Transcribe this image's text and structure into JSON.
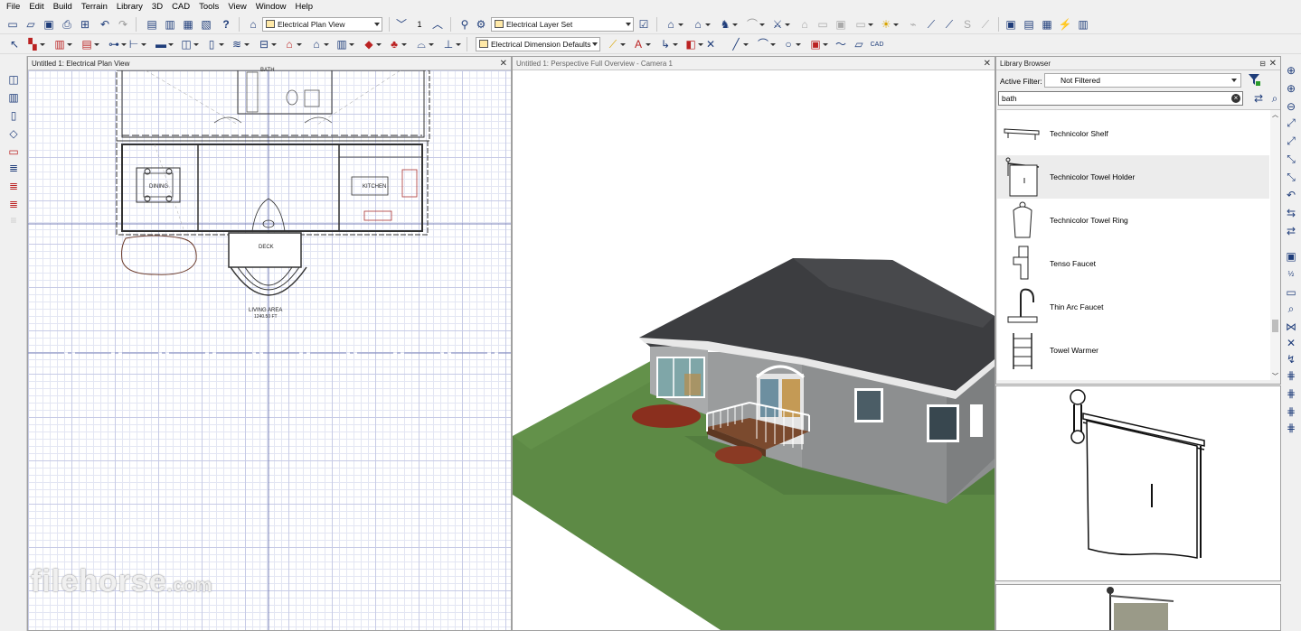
{
  "menu": [
    "File",
    "Edit",
    "Build",
    "Terrain",
    "Library",
    "3D",
    "CAD",
    "Tools",
    "View",
    "Window",
    "Help"
  ],
  "toolbar": {
    "view_select": "Electrical Plan View",
    "floor_number": "1",
    "layer_set": "Electrical Layer Set",
    "dimension_defaults": "Electrical Dimension Defaults"
  },
  "panes": {
    "plan": {
      "title": "Untitled 1: Electrical Plan View",
      "rooms": {
        "bath": "BATH",
        "dining": "DINING",
        "kitchen": "KITCHEN",
        "deck": "DECK",
        "living": "LIVING AREA",
        "living_area": "1240.50 FT"
      }
    },
    "perspective": {
      "title": "Untitled 1: Perspective Full Overview - Camera 1"
    },
    "library": {
      "title": "Library Browser",
      "filter_label": "Active Filter:",
      "filter_value": "Not Filtered",
      "search_value": "bath",
      "items": [
        {
          "label": "Technicolor Shelf",
          "icon": "shelf-icon"
        },
        {
          "label": "Technicolor Towel Holder",
          "icon": "towel-holder-icon",
          "selected": true
        },
        {
          "label": "Technicolor Towel Ring",
          "icon": "towel-ring-icon"
        },
        {
          "label": "Tenso Faucet",
          "icon": "faucet-icon"
        },
        {
          "label": "Thin Arc Faucet",
          "icon": "arc-faucet-icon"
        },
        {
          "label": "Towel Warmer",
          "icon": "towel-warmer-icon"
        }
      ]
    }
  },
  "watermark": {
    "name": "filehorse",
    "suffix": ".com"
  },
  "colors": {
    "grid": "#c7cbe6",
    "roof": "#3c3d40",
    "wall": "#9a9c9d",
    "grass": "#5d8a45",
    "accent": "#1f3d7a"
  }
}
